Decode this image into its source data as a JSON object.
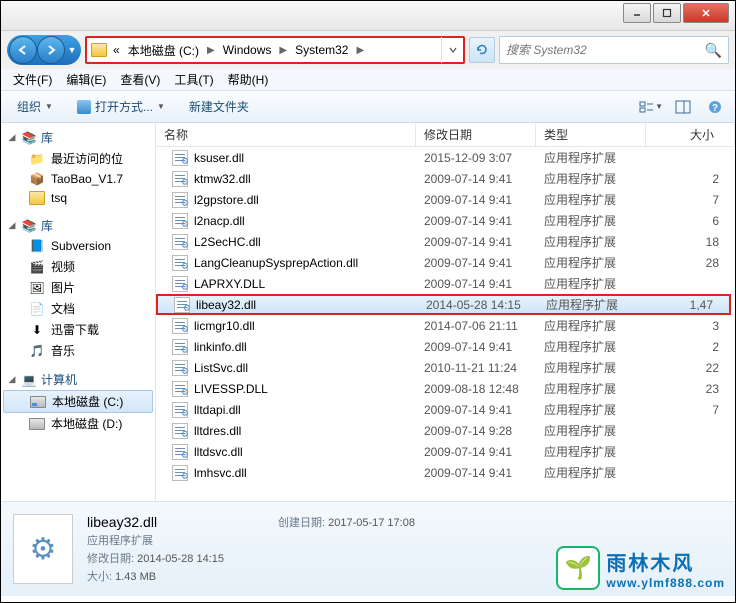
{
  "window": {
    "minimize": "–",
    "maximize": "□",
    "close": "✕"
  },
  "address": {
    "prefix": "«",
    "crumbs": [
      "本地磁盘 (C:)",
      "Windows",
      "System32"
    ],
    "search_placeholder": "搜索 System32"
  },
  "menu": {
    "file": "文件(F)",
    "edit": "编辑(E)",
    "view": "查看(V)",
    "tools": "工具(T)",
    "help": "帮助(H)"
  },
  "toolbar": {
    "organize": "组织",
    "openwith": "打开方式...",
    "newfolder": "新建文件夹"
  },
  "sidebar": {
    "libraries_label": "库",
    "lib_items": [
      {
        "label": "最近访问的位"
      },
      {
        "label": "TaoBao_V1.7"
      },
      {
        "label": "tsq"
      }
    ],
    "libraries2_label": "库",
    "lib2_items": [
      {
        "label": "Subversion"
      },
      {
        "label": "视频"
      },
      {
        "label": "图片"
      },
      {
        "label": "文档"
      },
      {
        "label": "迅雷下载"
      },
      {
        "label": "音乐"
      }
    ],
    "computer_label": "计算机",
    "drives": [
      {
        "label": "本地磁盘 (C:)",
        "selected": true
      },
      {
        "label": "本地磁盘 (D:)"
      }
    ]
  },
  "columns": {
    "name": "名称",
    "date": "修改日期",
    "type": "类型",
    "size": "大小"
  },
  "files": [
    {
      "name": "ksuser.dll",
      "date": "2015-12-09 3:07",
      "type": "应用程序扩展",
      "size": ""
    },
    {
      "name": "ktmw32.dll",
      "date": "2009-07-14 9:41",
      "type": "应用程序扩展",
      "size": "2"
    },
    {
      "name": "l2gpstore.dll",
      "date": "2009-07-14 9:41",
      "type": "应用程序扩展",
      "size": "7"
    },
    {
      "name": "l2nacp.dll",
      "date": "2009-07-14 9:41",
      "type": "应用程序扩展",
      "size": "6"
    },
    {
      "name": "L2SecHC.dll",
      "date": "2009-07-14 9:41",
      "type": "应用程序扩展",
      "size": "18"
    },
    {
      "name": "LangCleanupSysprepAction.dll",
      "date": "2009-07-14 9:41",
      "type": "应用程序扩展",
      "size": "28"
    },
    {
      "name": "LAPRXY.DLL",
      "date": "2009-07-14 9:41",
      "type": "应用程序扩展",
      "size": ""
    },
    {
      "name": "libeay32.dll",
      "date": "2014-05-28 14:15",
      "type": "应用程序扩展",
      "size": "1,47",
      "highlight": true
    },
    {
      "name": "licmgr10.dll",
      "date": "2014-07-06 21:11",
      "type": "应用程序扩展",
      "size": "3"
    },
    {
      "name": "linkinfo.dll",
      "date": "2009-07-14 9:41",
      "type": "应用程序扩展",
      "size": "2"
    },
    {
      "name": "ListSvc.dll",
      "date": "2010-11-21 11:24",
      "type": "应用程序扩展",
      "size": "22"
    },
    {
      "name": "LIVESSP.DLL",
      "date": "2009-08-18 12:48",
      "type": "应用程序扩展",
      "size": "23"
    },
    {
      "name": "lltdapi.dll",
      "date": "2009-07-14 9:41",
      "type": "应用程序扩展",
      "size": "7"
    },
    {
      "name": "lltdres.dll",
      "date": "2009-07-14 9:28",
      "type": "应用程序扩展",
      "size": ""
    },
    {
      "name": "lltdsvc.dll",
      "date": "2009-07-14 9:41",
      "type": "应用程序扩展",
      "size": ""
    },
    {
      "name": "lmhsvc.dll",
      "date": "2009-07-14 9:41",
      "type": "应用程序扩展",
      "size": ""
    }
  ],
  "details": {
    "filename": "libeay32.dll",
    "filetype": "应用程序扩展",
    "modified_label": "修改日期:",
    "modified_value": "2014-05-28 14:15",
    "size_label": "大小:",
    "size_value": "1.43 MB",
    "created_label": "创建日期:",
    "created_value": "2017-05-17 17:08"
  },
  "watermark": {
    "title": "雨林木风",
    "url": "www.ylmf888.com"
  }
}
